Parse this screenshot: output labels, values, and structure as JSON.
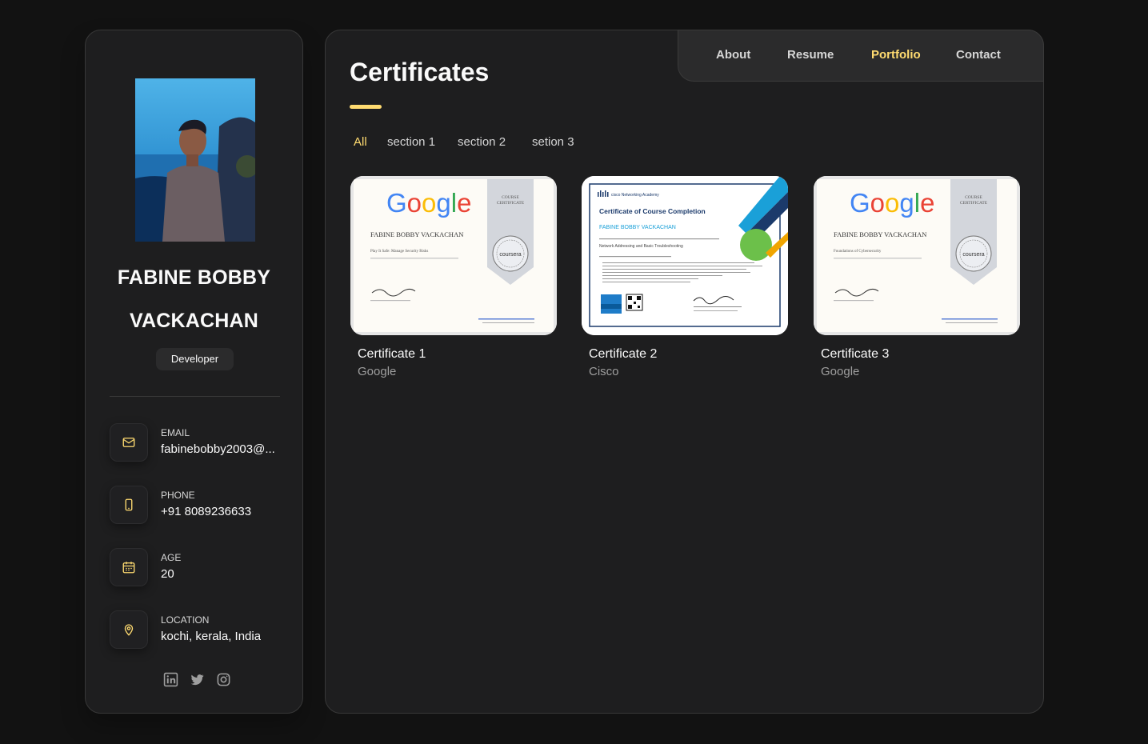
{
  "profile": {
    "name": "FABINE BOBBY VACKACHAN",
    "name_line1": "FABINE BOBBY",
    "name_line2": "VACKACHAN",
    "role": "Developer",
    "contacts": [
      {
        "label": "EMAIL",
        "value": "fabinebobby2003@...",
        "icon": "mail-icon"
      },
      {
        "label": "PHONE",
        "value": "+91 8089236633",
        "icon": "phone-icon"
      },
      {
        "label": "AGE",
        "value": "20",
        "icon": "calendar-icon"
      },
      {
        "label": "LOCATION",
        "value": "kochi, kerala, India",
        "icon": "location-pin-icon"
      }
    ],
    "socials": [
      "linkedin-icon",
      "twitter-icon",
      "instagram-icon"
    ]
  },
  "nav": {
    "items": [
      "About",
      "Resume",
      "Portfolio",
      "Contact"
    ],
    "active": "Portfolio"
  },
  "page": {
    "title": "Certificates",
    "filters": [
      "All",
      "section 1",
      "section 2",
      "setion 3"
    ],
    "active_filter": "All"
  },
  "certificates": [
    {
      "title": "Certificate 1",
      "issuer": "Google",
      "thumb": {
        "brand": "Google",
        "ribbon": "COURSE CERTIFICATE",
        "recipient": "FABINE BOBBY VACKACHAN",
        "course": "Play It Safe: Manage Security Risks",
        "seal": "coursera"
      }
    },
    {
      "title": "Certificate 2",
      "issuer": "Cisco",
      "thumb": {
        "brand": "cisco Networking Academy",
        "heading": "Certificate of Course Completion",
        "recipient": "FABINE BOBBY VACKACHAN",
        "course": "Network Addressing and Basic Troubleshooting"
      }
    },
    {
      "title": "Certificate 3",
      "issuer": "Google",
      "thumb": {
        "brand": "Google",
        "ribbon": "COURSE CERTIFICATE",
        "recipient": "FABINE BOBBY VACKACHAN",
        "course": "Foundations of Cybersecurity",
        "seal": "coursera"
      }
    }
  ],
  "colors": {
    "accent": "#ffdb70",
    "background": "#121212",
    "panel": "#1e1e1f"
  }
}
